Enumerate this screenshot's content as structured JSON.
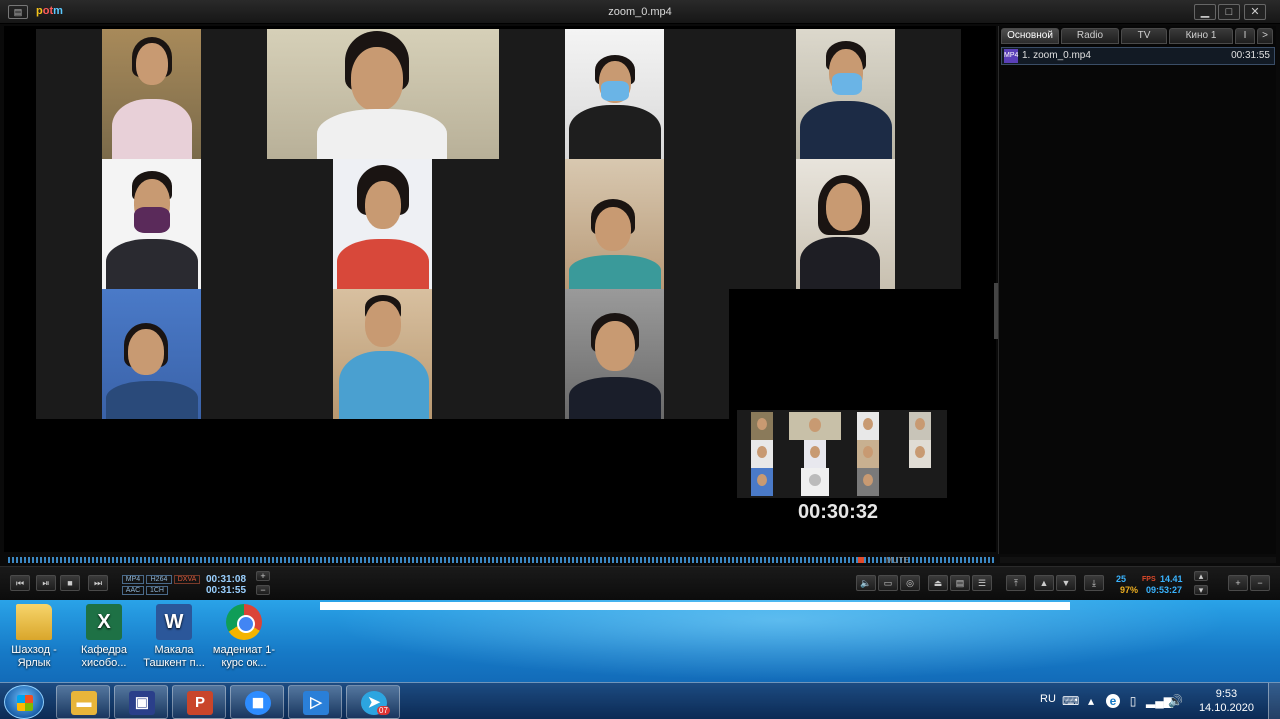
{
  "player": {
    "title": "zoom_0.mp4",
    "logo": [
      "p",
      "ot",
      "m"
    ],
    "timecode_overlay": "00:30:32",
    "tabs": [
      "Основной",
      "Radio",
      "TV",
      "Кино 1",
      "I",
      ">"
    ],
    "playlist": [
      {
        "label": "1. zoom_0.mp4",
        "duration": "00:31:55",
        "format": "MP4"
      }
    ],
    "mute_label": "MUTE",
    "codec_badges": [
      "MP4",
      "H264",
      "DXVA",
      "AAC",
      "1CH"
    ],
    "time_current": "00:31:08",
    "time_total": "00:31:55",
    "stats": {
      "fps_a": "25",
      "fps_label": "FPS",
      "fps_b": "14.41",
      "percent": "97%",
      "clock": "09:53:27"
    }
  },
  "desktop": {
    "icons": [
      {
        "label": "Шахзод - Ярлык",
        "icon": "folder-icon"
      },
      {
        "label": "Кафедра хисобо...",
        "icon": "excel-icon"
      },
      {
        "label": "Макала Ташкент п...",
        "icon": "word-icon"
      },
      {
        "label": "мадениат 1-курс ок...",
        "icon": "chrome-icon"
      }
    ]
  },
  "taskbar": {
    "buttons": [
      {
        "name": "explorer",
        "glyph": "📁",
        "color": "#e8b53a"
      },
      {
        "name": "save",
        "glyph": "💾",
        "color": "#2a3f8a"
      },
      {
        "name": "powerpoint",
        "glyph": "P",
        "color": "#c9452a"
      },
      {
        "name": "zoom",
        "glyph": "◼",
        "color": "#2d8cff"
      },
      {
        "name": "player",
        "glyph": "▷",
        "color": "#2a7fd8"
      },
      {
        "name": "telegram",
        "glyph": "➤",
        "color": "#2ca5e0",
        "badge": "07"
      }
    ],
    "tray": {
      "lang": "RU",
      "time": "9:53",
      "date": "14.10.2020"
    }
  },
  "colors": {
    "accent": "#3b88c4",
    "window_bg": "#0a0a0a"
  }
}
